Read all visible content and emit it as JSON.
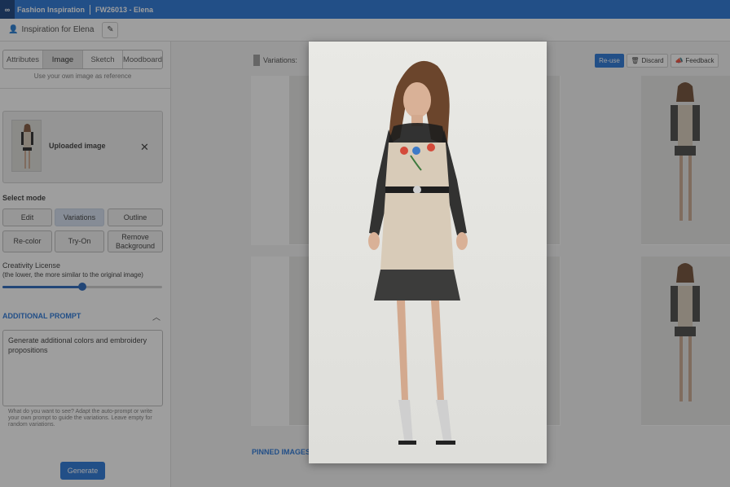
{
  "topbar": {
    "logo": "∞",
    "app_name": "Fashion Inspiration",
    "project": "FW26013 - Elena"
  },
  "subbar": {
    "title": "Inspiration for Elena"
  },
  "tabs": [
    {
      "label": "Attributes"
    },
    {
      "label": "Image"
    },
    {
      "label": "Sketch"
    },
    {
      "label": "Moodboard"
    }
  ],
  "image_tab_hint": "Use your own image as reference",
  "upload": {
    "label": "Uploaded image"
  },
  "select_mode": {
    "label": "Select mode",
    "options": [
      {
        "label": "Edit"
      },
      {
        "label": "Variations"
      },
      {
        "label": "Outline"
      },
      {
        "label": "Re-color"
      },
      {
        "label": "Try-On"
      },
      {
        "label": "Remove Background"
      }
    ]
  },
  "creativity": {
    "label": "Creativity License",
    "sublabel": "(the lower, the more similar to the original image)",
    "value": 0.5
  },
  "additional_prompt": {
    "label": "ADDITIONAL PROMPT",
    "value": "Generate additional colors and embroidery propositions",
    "help": "What do you want to see? Adapt the auto-prompt or write your own prompt to guide the variations. Leave empty for random variations."
  },
  "generate_label": "Generate",
  "main": {
    "variations_label": "Variations:",
    "reuse_label": "Re-use",
    "discard_label": "Discard",
    "feedback_label": "Feedback",
    "pinned_label": "PINNED IMAGES"
  },
  "icons": {
    "close": "✕",
    "chevron_up": "︿",
    "pencil": "✎",
    "person": "👤",
    "trash": "🗑",
    "feedback": "📣"
  },
  "colors": {
    "brand": "#1e6fd6",
    "brand_dark": "#0d3a78"
  }
}
